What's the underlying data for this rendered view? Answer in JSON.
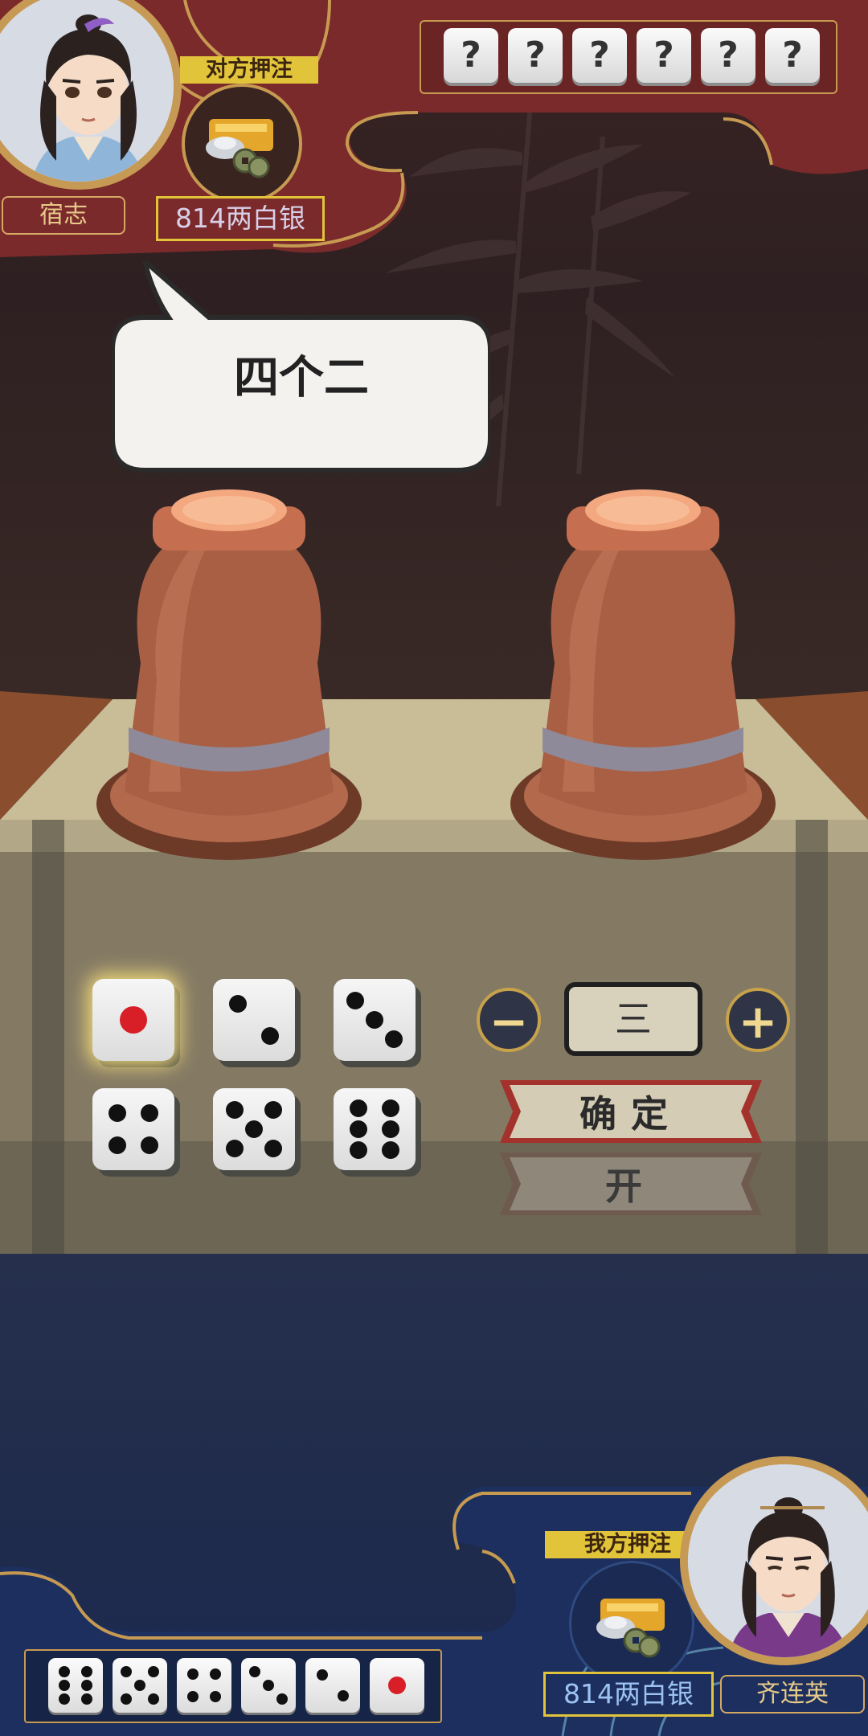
{
  "colors": {
    "opponent_banner": "#7a2a2a",
    "player_banner": "#1c2f5e",
    "gold_trim": "#c79a52",
    "bet_label_bg": "#e2c43a",
    "selected_die_glow": "#f2dc7a",
    "red_pip": "#d81e26"
  },
  "opponent": {
    "name": "宿志",
    "bet_label": "对方押注",
    "bet_amount": "814两白银",
    "hidden_dice": [
      "?",
      "?",
      "?",
      "?",
      "?",
      "?"
    ]
  },
  "bubble": {
    "text": "四个二"
  },
  "bid": {
    "face_options": [
      1,
      2,
      3,
      4,
      5,
      6
    ],
    "selected_face": 1,
    "count": "三",
    "minus_symbol": "−",
    "plus_symbol": "+",
    "confirm_label": "确定",
    "open_label": "开"
  },
  "player": {
    "name": "齐连英",
    "bet_label": "我方押注",
    "bet_amount": "814两白银",
    "dice": [
      6,
      5,
      4,
      3,
      2,
      1
    ]
  },
  "icons": {
    "bet_icon": "silver-ingot-coins-icon",
    "dice_cup": "dice-cup-icon"
  }
}
